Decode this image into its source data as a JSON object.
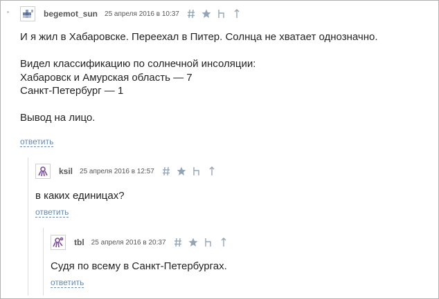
{
  "comments": [
    {
      "user": "begemot_sun",
      "date": "25 апреля 2016 в 10:37",
      "lines": [
        "И я жил в Хабаровске. Переехал в Питер. Солнца не хватает однозначно.",
        "",
        "Видел классификацию по солнечной инсоляции:",
        "Хабаровск и Амурская область — 7",
        "Санкт-Петербург — 1",
        "",
        "Вывод на лицо."
      ],
      "reply": "ответить"
    },
    {
      "user": "ksil",
      "date": "25 апреля 2016 в 12:57",
      "lines": [
        "в каких единицах?"
      ],
      "reply": "ответить"
    },
    {
      "user": "tbl",
      "date": "25 апреля 2016 в 20:37",
      "lines": [
        "Судя по всему в Санкт-Петербургах."
      ],
      "reply": "ответить"
    }
  ],
  "icons": [
    "hash-icon",
    "star-icon",
    "parent-link-icon",
    "up-arrow-icon"
  ],
  "colors": {
    "icon": "#93a4b5",
    "link": "#6a88aa",
    "avatar_purple": "#7a4a9a"
  }
}
